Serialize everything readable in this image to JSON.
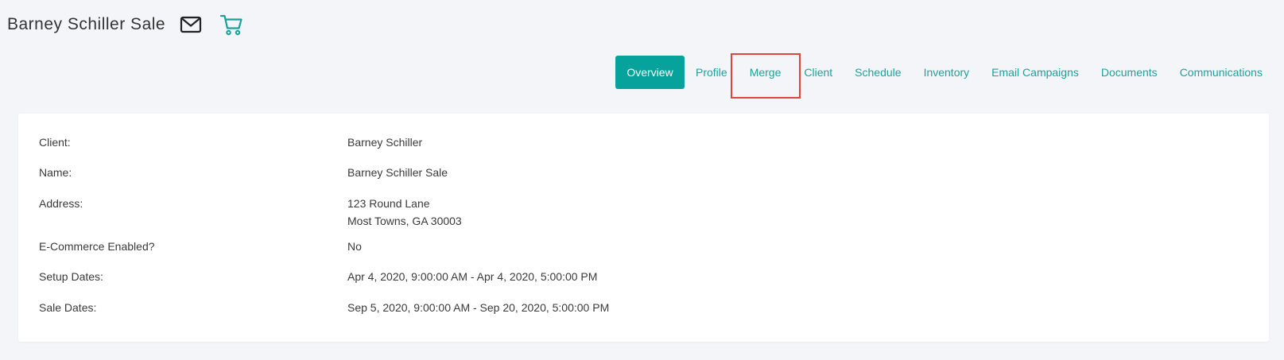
{
  "header": {
    "title": "Barney Schiller Sale",
    "icons": [
      "mail-icon",
      "cart-icon"
    ]
  },
  "tabs": [
    {
      "label": "Overview",
      "active": true
    },
    {
      "label": "Profile",
      "active": false
    },
    {
      "label": "Merge",
      "active": false
    },
    {
      "label": "Client",
      "active": false
    },
    {
      "label": "Schedule",
      "active": false
    },
    {
      "label": "Inventory",
      "active": false
    },
    {
      "label": "Email Campaigns",
      "active": false
    },
    {
      "label": "Documents",
      "active": false
    },
    {
      "label": "Communications",
      "active": false
    }
  ],
  "details": [
    {
      "label": "Client:",
      "value": "Barney Schiller"
    },
    {
      "label": "Name:",
      "value": "Barney Schiller Sale"
    },
    {
      "label": "Address:",
      "value": "123 Round Lane",
      "value2": "Most Towns, GA 30003"
    },
    {
      "label": "E-Commerce Enabled?",
      "value": "No"
    },
    {
      "label": "Setup Dates:",
      "value": "Apr 4, 2020, 9:00:00 AM - Apr 4, 2020, 5:00:00 PM"
    },
    {
      "label": "Sale Dates:",
      "value": "Sep 5, 2020, 9:00:00 AM - Sep 20, 2020, 5:00:00 PM"
    }
  ],
  "colors": {
    "accent": "#07a29b",
    "link": "#1aa39c",
    "highlight": "#e0443b",
    "background": "#f4f5f9"
  }
}
